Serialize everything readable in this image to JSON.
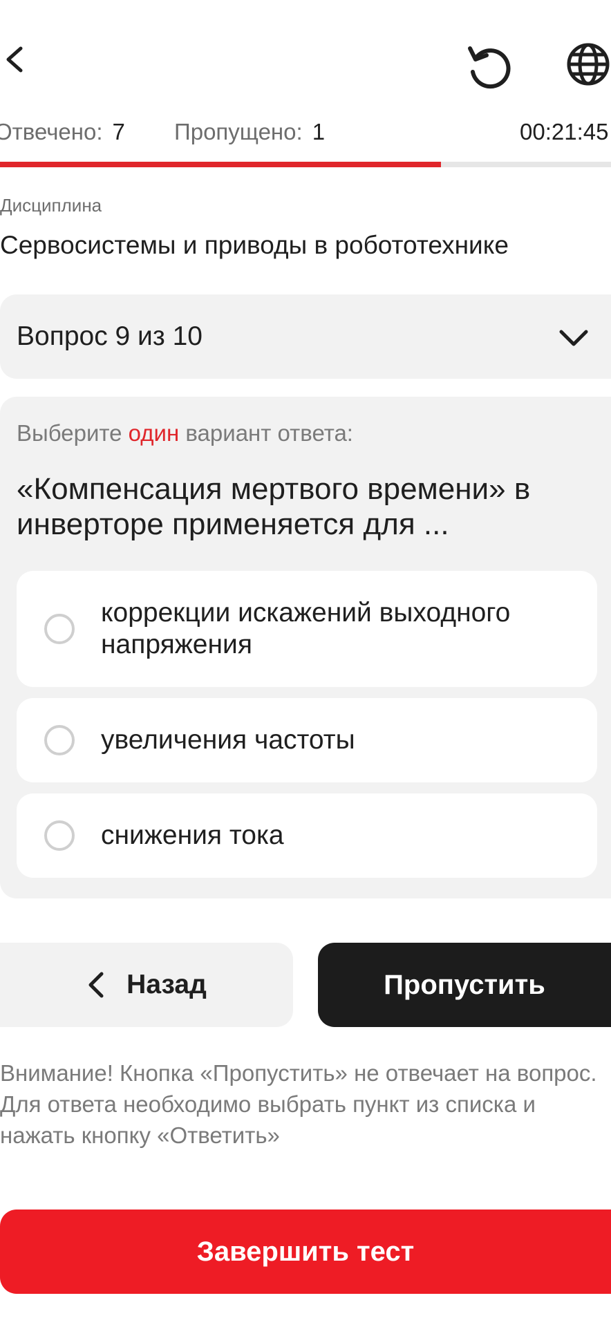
{
  "header": {
    "back_icon": "chevron-left-icon",
    "restart_icon": "restart-icon",
    "language_icon": "globe-icon"
  },
  "stats": {
    "answered_label": "Отвечено:",
    "answered_value": "7",
    "skipped_label": "Пропущено:",
    "skipped_value": "1",
    "timer": "00:21:45"
  },
  "progress": {
    "fraction": 0.722,
    "fill_color": "#e0262b",
    "track_color": "#e6e6e6"
  },
  "discipline": {
    "label": "Дисциплина",
    "value": "Сервосистемы и приводы в робототехнике"
  },
  "question_selector": {
    "label": "Вопрос 9 из 10",
    "icon": "chevron-down-icon"
  },
  "question": {
    "instruction_before": "Выберите ",
    "instruction_accent": "один",
    "instruction_after": " вариант ответа:",
    "text": "«Компенсация мертвого времени» в инверторе применяется для ...",
    "options": [
      {
        "label": "коррекции искажений выходного напряжения",
        "selected": false
      },
      {
        "label": "увеличения частоты",
        "selected": false
      },
      {
        "label": "снижения тока",
        "selected": false
      }
    ]
  },
  "actions": {
    "back_label": "Назад",
    "skip_label": "Пропустить",
    "note": "Внимание! Кнопка «Пропустить» не отвечает на вопрос. Для ответа необходимо выбрать пункт из списка и нажать кнопку «Ответить»",
    "finish_label": "Завершить тест"
  },
  "colors": {
    "accent": "#e0262b",
    "finish_button": "#ee1c25",
    "skip_button": "#1c1c1c",
    "panel": "#f2f2f2"
  }
}
